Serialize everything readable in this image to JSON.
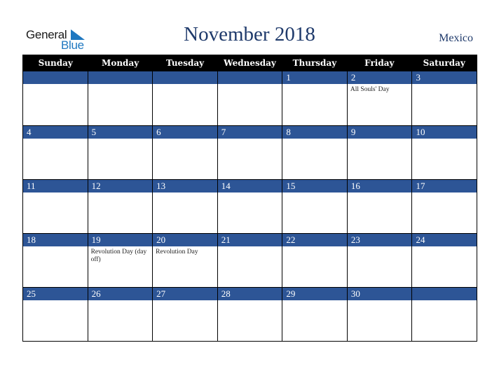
{
  "logo": {
    "line1": "General",
    "line2": "Blue"
  },
  "header": {
    "title": "November 2018",
    "country": "Mexico"
  },
  "weekdays": [
    "Sunday",
    "Monday",
    "Tuesday",
    "Wednesday",
    "Thursday",
    "Friday",
    "Saturday"
  ],
  "weeks": [
    [
      {
        "day": "",
        "event": ""
      },
      {
        "day": "",
        "event": ""
      },
      {
        "day": "",
        "event": ""
      },
      {
        "day": "",
        "event": ""
      },
      {
        "day": "1",
        "event": ""
      },
      {
        "day": "2",
        "event": "All Souls' Day"
      },
      {
        "day": "3",
        "event": ""
      }
    ],
    [
      {
        "day": "4",
        "event": ""
      },
      {
        "day": "5",
        "event": ""
      },
      {
        "day": "6",
        "event": ""
      },
      {
        "day": "7",
        "event": ""
      },
      {
        "day": "8",
        "event": ""
      },
      {
        "day": "9",
        "event": ""
      },
      {
        "day": "10",
        "event": ""
      }
    ],
    [
      {
        "day": "11",
        "event": ""
      },
      {
        "day": "12",
        "event": ""
      },
      {
        "day": "13",
        "event": ""
      },
      {
        "day": "14",
        "event": ""
      },
      {
        "day": "15",
        "event": ""
      },
      {
        "day": "16",
        "event": ""
      },
      {
        "day": "17",
        "event": ""
      }
    ],
    [
      {
        "day": "18",
        "event": ""
      },
      {
        "day": "19",
        "event": "Revolution Day (day off)"
      },
      {
        "day": "20",
        "event": "Revolution Day"
      },
      {
        "day": "21",
        "event": ""
      },
      {
        "day": "22",
        "event": ""
      },
      {
        "day": "23",
        "event": ""
      },
      {
        "day": "24",
        "event": ""
      }
    ],
    [
      {
        "day": "25",
        "event": ""
      },
      {
        "day": "26",
        "event": ""
      },
      {
        "day": "27",
        "event": ""
      },
      {
        "day": "28",
        "event": ""
      },
      {
        "day": "29",
        "event": ""
      },
      {
        "day": "30",
        "event": ""
      },
      {
        "day": "",
        "event": ""
      }
    ]
  ],
  "colors": {
    "header_bg": "#000000",
    "day_bar": "#2d5596",
    "title": "#1f3a6b",
    "logo_blue": "#1f78c0"
  }
}
